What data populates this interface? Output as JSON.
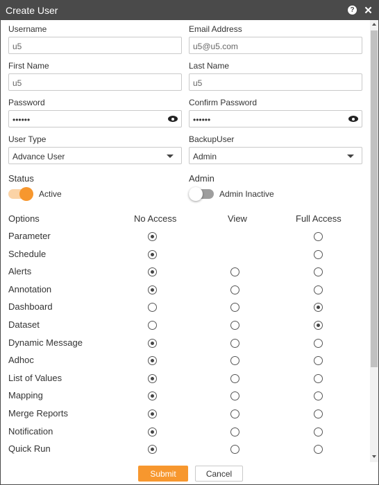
{
  "dialog": {
    "title": "Create User"
  },
  "form": {
    "username": {
      "label": "Username",
      "value": "u5"
    },
    "email": {
      "label": "Email Address",
      "value": "u5@u5.com"
    },
    "first_name": {
      "label": "First Name",
      "value": "u5"
    },
    "last_name": {
      "label": "Last Name",
      "value": "u5"
    },
    "password": {
      "label": "Password",
      "value": "••••••"
    },
    "confirm_password": {
      "label": "Confirm Password",
      "value": "••••••"
    },
    "user_type": {
      "label": "User Type",
      "value": "Advance User"
    },
    "backup_user": {
      "label": "BackupUser",
      "value": "Admin"
    },
    "status": {
      "label": "Status",
      "state_label": "Active",
      "on": true
    },
    "admin": {
      "label": "Admin",
      "state_label": "Admin Inactive",
      "on": false
    }
  },
  "permissions": {
    "headers": {
      "options": "Options",
      "no_access": "No Access",
      "view": "View",
      "full_access": "Full Access"
    },
    "rows": [
      {
        "label": "Parameter",
        "selected": "no_access",
        "has_view": false
      },
      {
        "label": "Schedule",
        "selected": "no_access",
        "has_view": false
      },
      {
        "label": "Alerts",
        "selected": "no_access",
        "has_view": true
      },
      {
        "label": "Annotation",
        "selected": "no_access",
        "has_view": true
      },
      {
        "label": "Dashboard",
        "selected": "full_access",
        "has_view": true
      },
      {
        "label": "Dataset",
        "selected": "full_access",
        "has_view": true
      },
      {
        "label": "Dynamic Message",
        "selected": "no_access",
        "has_view": true
      },
      {
        "label": "Adhoc",
        "selected": "no_access",
        "has_view": true
      },
      {
        "label": "List of Values",
        "selected": "no_access",
        "has_view": true
      },
      {
        "label": "Mapping",
        "selected": "no_access",
        "has_view": true
      },
      {
        "label": "Merge Reports",
        "selected": "no_access",
        "has_view": true
      },
      {
        "label": "Notification",
        "selected": "no_access",
        "has_view": true
      },
      {
        "label": "Quick Run",
        "selected": "no_access",
        "has_view": true
      }
    ]
  },
  "actions": {
    "submit": "Submit",
    "cancel": "Cancel"
  },
  "colors": {
    "accent": "#f7972e",
    "titlebar": "#4a4a4a"
  },
  "icons": {
    "help": "help-icon",
    "close": "close-icon",
    "eye": "eye-icon",
    "caret": "chevron-down-icon"
  }
}
